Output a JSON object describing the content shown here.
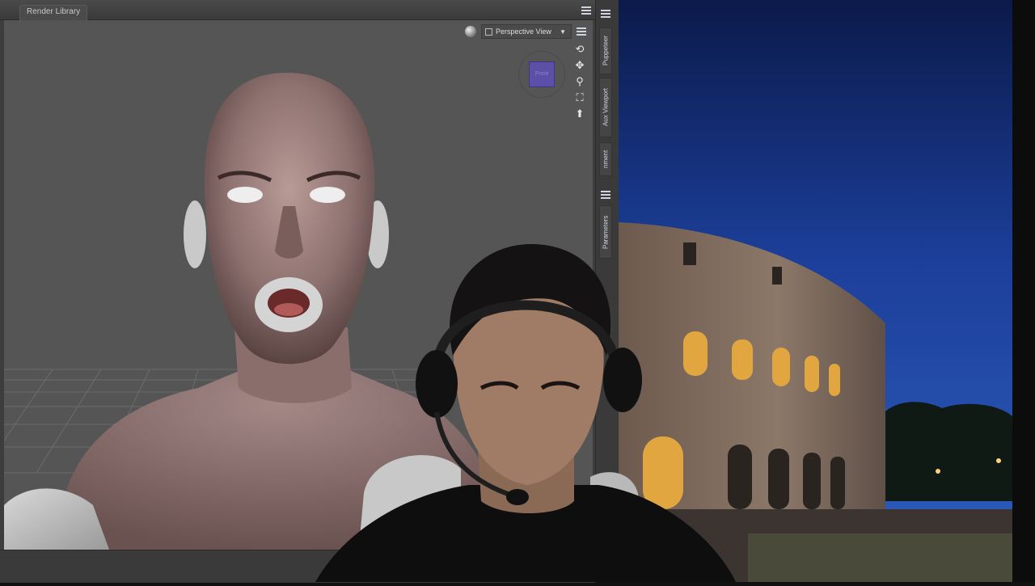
{
  "tabbar": {
    "tab_label": "Render Library"
  },
  "viewport": {
    "view_select_label": "Perspective View",
    "cube_face_label": "Front"
  },
  "side_tabs": {
    "puppeteer": "Puppeteer",
    "aux_viewport": "Aux Viewport",
    "alignment": "nment",
    "parameters": "Parameters"
  },
  "icons": {
    "panel_menu": "menu-lines-icon",
    "draw_style": "sphere-icon",
    "orbit": "orbit-icon",
    "pan": "move-arrows-icon",
    "zoom": "magnifier-icon",
    "frame": "frame-icon",
    "reset": "reset-icon"
  },
  "colors": {
    "viewport_bg": "#555555",
    "panel_bg": "#3d3d3d",
    "cube_face": "#5b4fa8"
  }
}
